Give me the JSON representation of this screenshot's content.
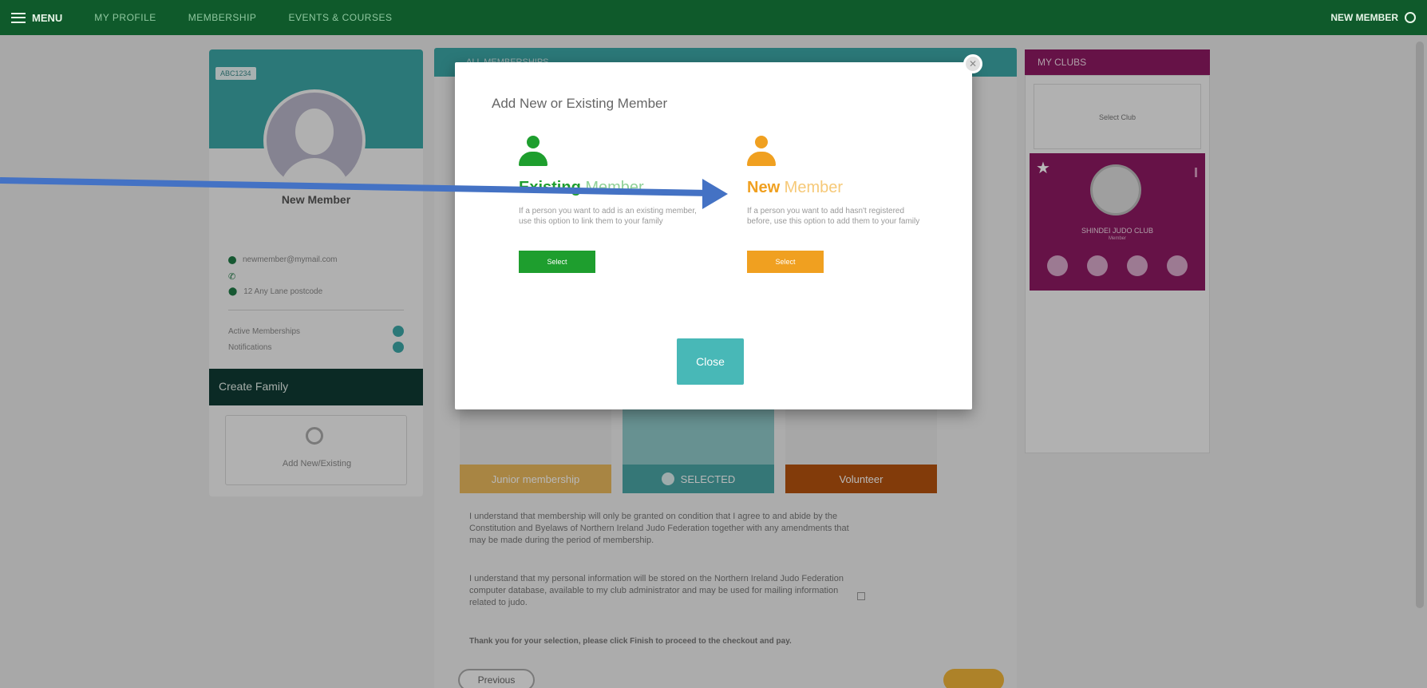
{
  "nav": {
    "menu_label": "MENU",
    "items": [
      "MY PROFILE",
      "MEMBERSHIP",
      "EVENTS & COURSES"
    ],
    "user_label": "NEW MEMBER"
  },
  "profile": {
    "badge": "ABC1234",
    "name": "New Member",
    "email": "newmember@mymail.com",
    "address": "12 Any Lane postcode",
    "stats": [
      {
        "label": "Active Memberships"
      },
      {
        "label": "Notifications"
      }
    ],
    "family_title": "Create Family",
    "family_add_label": "Add New/Existing"
  },
  "center": {
    "header_label": "ALL MEMBERSHIPS",
    "options": [
      {
        "label": "Junior membership",
        "color": "#e9b95e"
      },
      {
        "label": "SELECTED",
        "color": "#4aa6a6"
      },
      {
        "label": "Volunteer",
        "color": "#b4530f"
      }
    ],
    "para1": "I understand that membership will only be granted on condition that I agree to and abide by the Constitution and Byelaws of Northern Ireland Judo Federation together with any amendments that may be made during the period of membership.",
    "para2": "I understand that my personal information will be stored on the Northern Ireland Judo Federation computer database, available to my club administrator and may be used for mailing information related to judo.",
    "para3": "Thank you for your selection, please click Finish to proceed to the checkout and pay.",
    "previous_label": "Previous"
  },
  "clubs": {
    "header": "MY CLUBS",
    "select_label": "Select Club",
    "club_name": "SHINDEI JUDO CLUB",
    "club_sub": "Member"
  },
  "modal": {
    "title": "Add New or Existing Member",
    "existing": {
      "title_bold": "Existing",
      "title_rest": " Member",
      "desc": "If a person you want to add is an existing member, use this option to link them to your family",
      "select_label": "Select",
      "color": "#1e9e2e"
    },
    "new": {
      "title_bold": "New",
      "title_rest": " Member",
      "desc": "If a person you want to add hasn't registered before, use this option to add them to your family",
      "select_label": "Select",
      "color": "#f0a020"
    },
    "close_label": "Close"
  },
  "colors": {
    "nav_bg": "#0f5a2b",
    "teal": "#3ca7a7",
    "club_purple": "#8e1a63",
    "annotation_arrow": "#4472c4"
  },
  "icons": [
    "menu-icon",
    "gear-icon",
    "avatar-icon",
    "email-icon",
    "phone-icon",
    "location-icon",
    "plus-circle-icon",
    "person-icon",
    "check-circle-icon",
    "star-icon",
    "close-icon",
    "info-icon",
    "message-icon",
    "home-icon",
    "group-icon"
  ]
}
